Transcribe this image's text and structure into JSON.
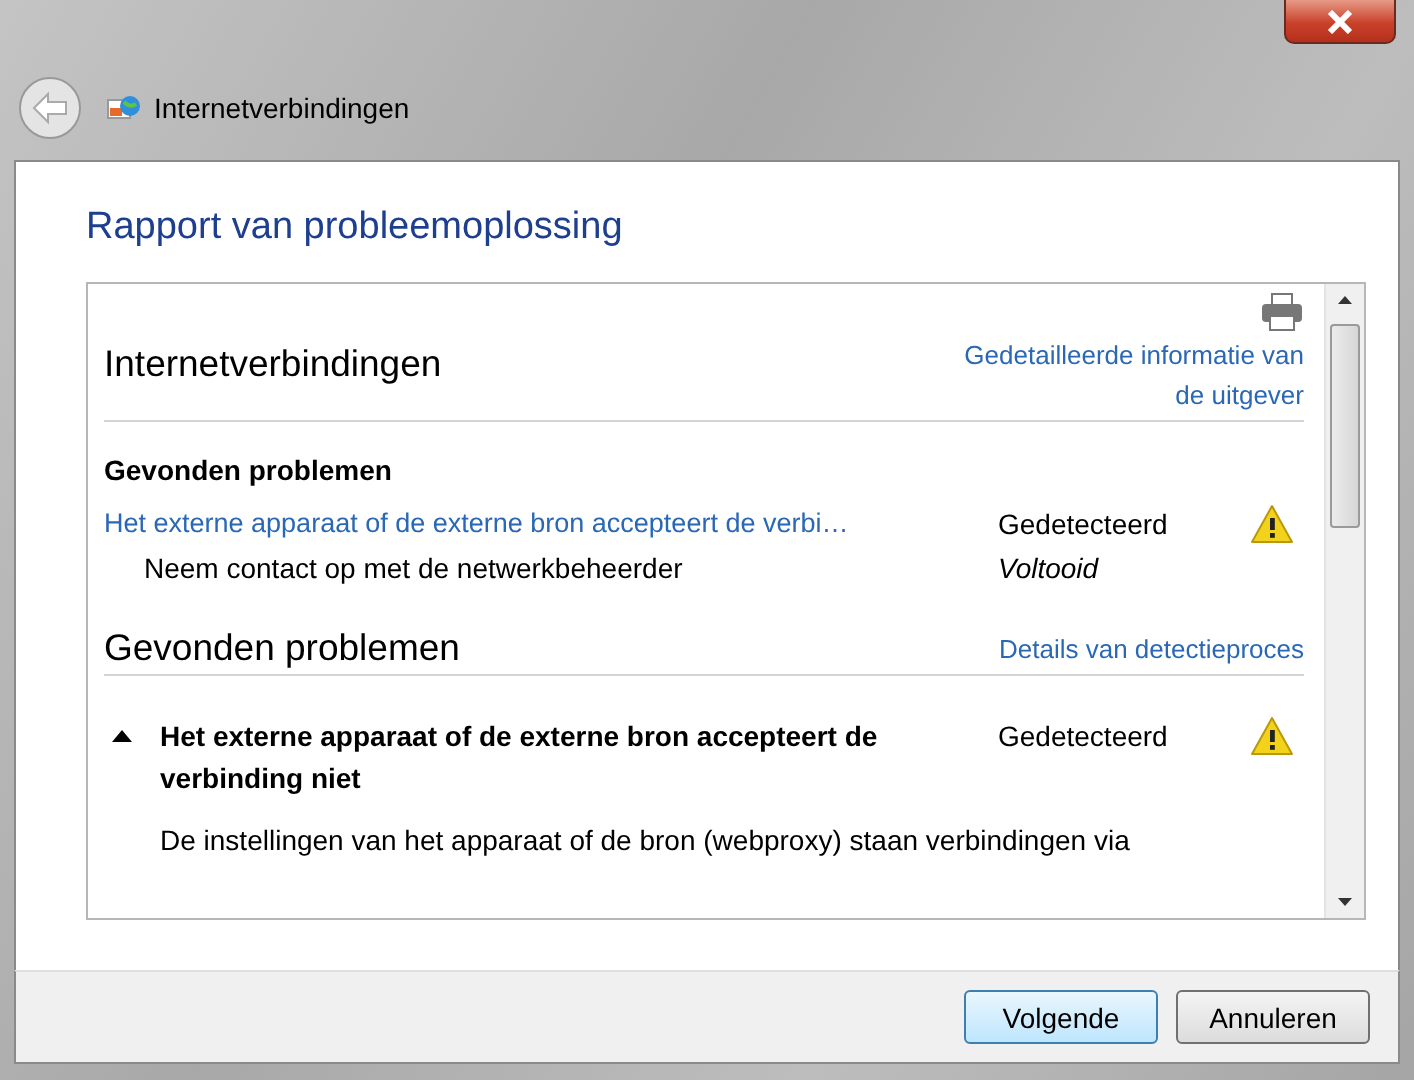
{
  "window": {
    "title": "Internetverbindingen"
  },
  "heading": "Rapport van probleemoplossing",
  "report": {
    "title": "Internetverbindingen",
    "publisher_link": "Gedetailleerde informatie van de uitgever",
    "found_heading": "Gevonden problemen",
    "problems": [
      {
        "title": "Het externe apparaat of de externe bron accepteert de verbi…",
        "status": "Gedetecteerd",
        "warning": true,
        "steps": [
          {
            "text": "Neem contact op met de netwerkbeheerder",
            "status": "Voltooid"
          }
        ]
      }
    ]
  },
  "details": {
    "title": "Gevonden problemen",
    "link": "Details van detectieproces",
    "items": [
      {
        "title": "Het externe apparaat of de externe bron accepteert de verbinding niet",
        "status": "Gedetecteerd",
        "warning": true,
        "expanded": true,
        "description": "De instellingen van het apparaat of de bron (webproxy) staan verbindingen via"
      }
    ]
  },
  "buttons": [
    {
      "label": "Volgende",
      "default": true
    },
    {
      "label": "Annuleren",
      "default": false
    }
  ]
}
